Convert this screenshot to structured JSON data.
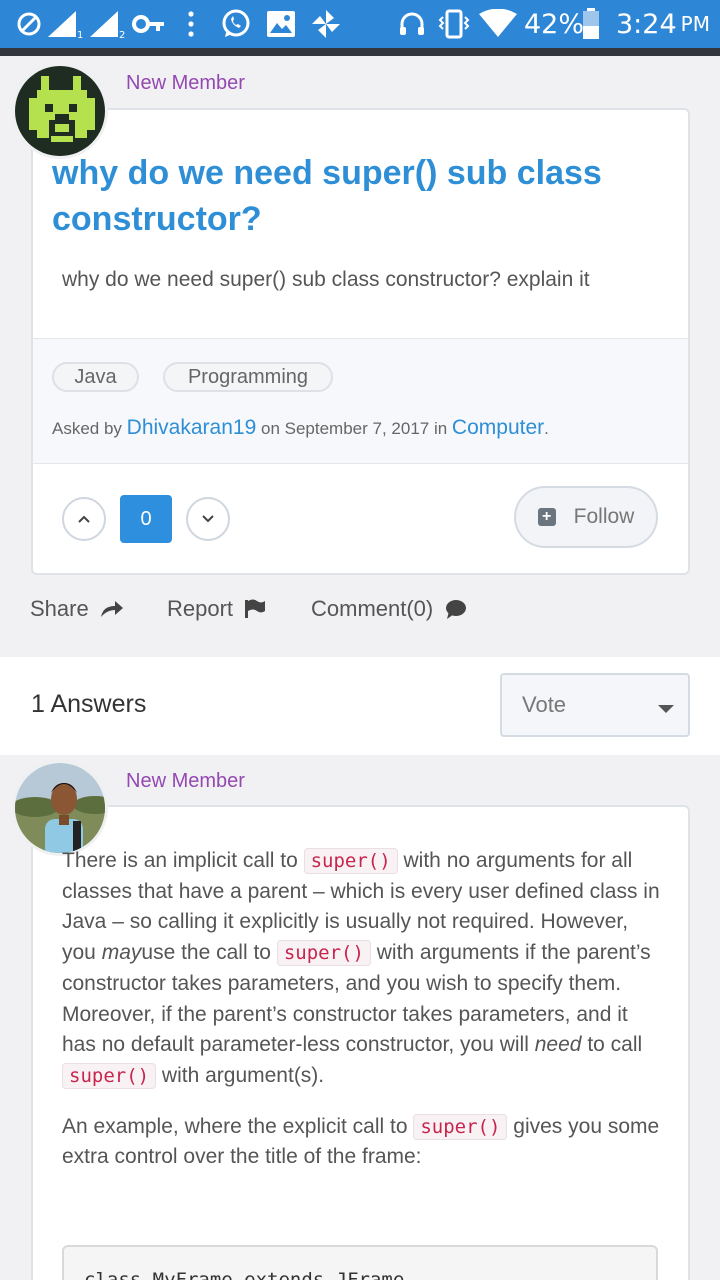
{
  "status_bar": {
    "battery": "42%",
    "time": "3:24",
    "ampm": "PM",
    "bg": "#2d87d6"
  },
  "question": {
    "member_label": "New Member",
    "title": "why do we need super() sub class constructor?",
    "body": "why do we need super() sub class constructor? explain it",
    "tags": [
      "Java",
      "Programming"
    ],
    "asked_prefix": "Asked by",
    "author": "Dhivakaran19",
    "date_text": "on September 7, 2017 in",
    "category": "Computer",
    "category_suffix": ".",
    "votes": "0",
    "follow_label": "Follow"
  },
  "actions": {
    "share": "Share",
    "report": "Report",
    "comment": "Comment(0)"
  },
  "answers_bar": {
    "count_label": "1 Answers",
    "sort_selected": "Vote"
  },
  "answer": {
    "member_label": "New Member",
    "p1_a": "There is an implicit call to",
    "code_super": "super()",
    "p1_b": "with no arguments for all classes that have a parent – which is every user defined class in Java – so calling it explicitly is usually not required. However, you",
    "p1_em_may": "may",
    "p1_c": "use the call to",
    "p1_d": "with arguments if the parent’s constructor takes parameters, and you wish to specify them. Moreover, if the parent’s constructor takes parameters, and it has no default parameter-less constructor, you will",
    "p1_em_need": "need",
    "p1_e": "to call",
    "p1_f": "with argument(s).",
    "p2_a": "An example, where the explicit call to",
    "p2_b": "gives you some extra control over the title of the frame:",
    "code_block": "class MyFrame extends JFrame"
  },
  "colors": {
    "link_blue": "#2e8fd6",
    "member_purple": "#9349b1",
    "code_red": "#c7254e"
  }
}
